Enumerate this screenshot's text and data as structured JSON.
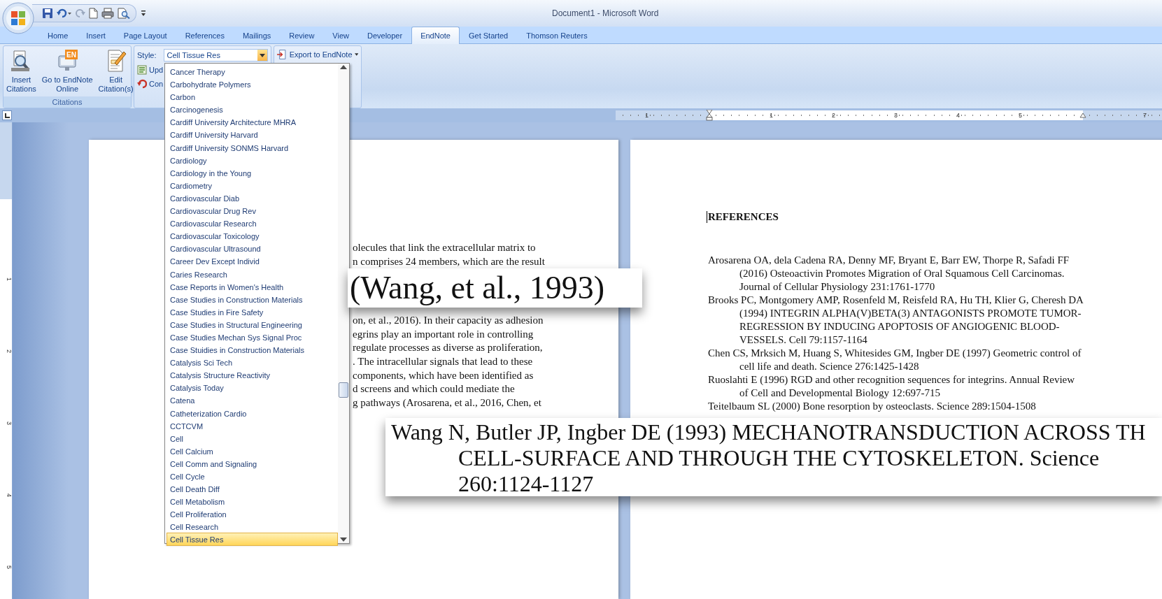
{
  "window": {
    "title": "Document1 - Microsoft Word"
  },
  "tabs": [
    {
      "label": "Home",
      "selected": false
    },
    {
      "label": "Insert",
      "selected": false
    },
    {
      "label": "Page Layout",
      "selected": false
    },
    {
      "label": "References",
      "selected": false
    },
    {
      "label": "Mailings",
      "selected": false
    },
    {
      "label": "Review",
      "selected": false
    },
    {
      "label": "View",
      "selected": false
    },
    {
      "label": "Developer",
      "selected": false
    },
    {
      "label": "EndNote",
      "selected": true
    },
    {
      "label": "Get Started",
      "selected": false
    },
    {
      "label": "Thomson Reuters",
      "selected": false
    }
  ],
  "ribbon": {
    "citations_group": {
      "label": "Citations",
      "buttons": [
        {
          "kind": "insert",
          "label": "Insert\nCitations"
        },
        {
          "kind": "online",
          "label": "Go to EndNote\nOnline",
          "badge": "EN"
        },
        {
          "kind": "edit",
          "label": "Edit\nCitation(s)"
        }
      ]
    },
    "style_group": {
      "label": "Style:",
      "value": "Cell Tissue Res",
      "expanded": true,
      "commands": [
        {
          "kind": "update",
          "label": "Upd"
        },
        {
          "kind": "convert",
          "label": "Con"
        }
      ]
    },
    "export_button": {
      "label": "Export to EndNote"
    }
  },
  "style_dropdown": {
    "items": [
      {
        "label": "Cancer Therapy",
        "selected": false
      },
      {
        "label": "Carbohydrate Polymers",
        "selected": false
      },
      {
        "label": "Carbon",
        "selected": false
      },
      {
        "label": "Carcinogenesis",
        "selected": false
      },
      {
        "label": "Cardiff University Architecture MHRA",
        "selected": false
      },
      {
        "label": "Cardiff University Harvard",
        "selected": false
      },
      {
        "label": "Cardiff University SONMS Harvard",
        "selected": false
      },
      {
        "label": "Cardiology",
        "selected": false
      },
      {
        "label": "Cardiology in the Young",
        "selected": false
      },
      {
        "label": "Cardiometry",
        "selected": false
      },
      {
        "label": "Cardiovascular Diab",
        "selected": false
      },
      {
        "label": "Cardiovascular Drug Rev",
        "selected": false
      },
      {
        "label": "Cardiovascular Research",
        "selected": false
      },
      {
        "label": "Cardiovascular Toxicology",
        "selected": false
      },
      {
        "label": "Cardiovascular Ultrasound",
        "selected": false
      },
      {
        "label": "Career Dev Except Individ",
        "selected": false
      },
      {
        "label": "Caries Research",
        "selected": false
      },
      {
        "label": "Case Reports in Women's Health",
        "selected": false
      },
      {
        "label": "Case Studies in Construction Materials",
        "selected": false
      },
      {
        "label": "Case Studies in Fire Safety",
        "selected": false
      },
      {
        "label": "Case Studies in Structural Engineering",
        "selected": false
      },
      {
        "label": "Case Studies Mechan Sys Signal Proc",
        "selected": false
      },
      {
        "label": "Case Stuidies in Construction Materials",
        "selected": false
      },
      {
        "label": "Catalysis Sci Tech",
        "selected": false
      },
      {
        "label": "Catalysis Structure Reactivity",
        "selected": false
      },
      {
        "label": "Catalysis Today",
        "selected": false
      },
      {
        "label": "Catena",
        "selected": false
      },
      {
        "label": "Catheterization Cardio",
        "selected": false
      },
      {
        "label": "CCTCVM",
        "selected": false
      },
      {
        "label": "Cell",
        "selected": false
      },
      {
        "label": "Cell Calcium",
        "selected": false
      },
      {
        "label": "Cell Comm and Signaling",
        "selected": false
      },
      {
        "label": "Cell Cycle",
        "selected": false
      },
      {
        "label": "Cell Death Diff",
        "selected": false
      },
      {
        "label": "Cell Metabolism",
        "selected": false
      },
      {
        "label": "Cell Proliferation",
        "selected": false
      },
      {
        "label": "Cell Research",
        "selected": false
      },
      {
        "label": "Cell Tissue Res",
        "selected": true
      }
    ]
  },
  "ruler": {
    "ticks": [
      {
        "kind": "number",
        "label": "1"
      },
      {
        "kind": "indent"
      },
      {
        "kind": "number",
        "label": "1"
      },
      {
        "kind": "number",
        "label": "2"
      },
      {
        "kind": "number",
        "label": "3"
      },
      {
        "kind": "number",
        "label": "4"
      },
      {
        "kind": "number",
        "label": "5"
      },
      {
        "kind": "right-indent"
      },
      {
        "kind": "number",
        "label": "7"
      }
    ]
  },
  "vertical_ruler": {
    "labels": [
      "1",
      "2",
      "3",
      "4",
      "5"
    ]
  },
  "left_page": {
    "blocks": [
      {
        "lines": [
          "olecules that link the extracellular matrix to",
          "n comprises 24 members, which are the result"
        ]
      },
      {
        "lines": [
          "on, et al., 2016). In their capacity as adhesion",
          "egrins play an important role in controlling",
          "regulate processes as diverse as proliferation,",
          ". The intracellular signals that lead to these",
          "components, which have been identified as",
          "d screens and which could mediate the",
          "g pathways (Arosarena, et al., 2016, Chen, et"
        ]
      }
    ]
  },
  "right_page": {
    "heading": "REFERENCES",
    "references": [
      {
        "lines": [
          "Arosarena OA, dela Cadena RA, Denny MF, Bryant E, Barr EW, Thorpe R, Safadi FF",
          "(2016) Osteoactivin Promotes Migration of Oral Squamous Cell Carcinomas.",
          "Journal of Cellular Physiology 231:1761-1770"
        ]
      },
      {
        "lines": [
          "Brooks PC, Montgomery AMP, Rosenfeld M, Reisfeld RA, Hu TH, Klier G, Cheresh DA",
          "(1994) INTEGRIN ALPHA(V)BETA(3) ANTAGONISTS PROMOTE TUMOR-",
          "REGRESSION BY INDUCING APOPTOSIS OF ANGIOGENIC BLOOD-",
          "VESSELS. Cell 79:1157-1164"
        ]
      },
      {
        "lines": [
          "Chen CS, Mrksich M, Huang S, Whitesides GM, Ingber DE (1997) Geometric control of",
          "cell life and death. Science 276:1425-1428"
        ]
      },
      {
        "lines": [
          "Ruoslahti E (1996) RGD and other recognition sequences for integrins. Annual Review",
          "of Cell and Developmental Biology 12:697-715"
        ]
      },
      {
        "lines": [
          "Teitelbaum SL (2000) Bone resorption by osteoclasts. Science 289:1504-1508"
        ]
      }
    ]
  },
  "zoom_callouts": [
    {
      "kind": "citation",
      "lines": [
        "(Wang, et al., 1993)"
      ]
    },
    {
      "kind": "reference",
      "lines": [
        "Wang N, Butler JP, Ingber DE (1993) MECHANOTRANSDUCTION ACROSS TH",
        "CELL-SURFACE AND THROUGH THE CYTOSKELETON. Science",
        "260:1124-1127"
      ]
    }
  ]
}
